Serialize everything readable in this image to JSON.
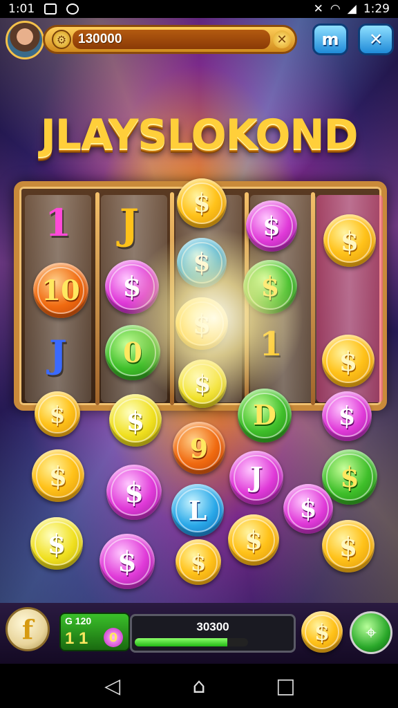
{
  "status_bar": {
    "time_left": "1:01",
    "time_right": "1:29"
  },
  "header": {
    "balance": "130000",
    "close_symbol": "✕",
    "menu_button_label": "m",
    "exit_button_label": "✕"
  },
  "game_title": "JLAYSLOKOND",
  "reel_symbols": [
    {
      "id": "r1-top",
      "label": "1",
      "style": "pink"
    },
    {
      "id": "r1-mid",
      "label": "10",
      "style": "orange"
    },
    {
      "id": "r1-bot",
      "label": "J",
      "style": "blue"
    },
    {
      "id": "r2-top",
      "label": "J",
      "style": "gold"
    },
    {
      "id": "r2-mid",
      "label": "$",
      "style": "pink"
    },
    {
      "id": "r2-bot",
      "label": "0",
      "style": "green"
    },
    {
      "id": "r3-top",
      "label": "$",
      "style": "gold"
    },
    {
      "id": "r3-mid",
      "label": "$",
      "style": "blue"
    },
    {
      "id": "r3-mid2",
      "label": "$",
      "style": "gold"
    },
    {
      "id": "r3-bot",
      "label": "$",
      "style": "yellow"
    },
    {
      "id": "r4-top",
      "label": "$",
      "style": "pink"
    },
    {
      "id": "r4-mid",
      "label": "$",
      "style": "green"
    },
    {
      "id": "r4-bot",
      "label": "1",
      "style": "gold"
    },
    {
      "id": "r5-top",
      "label": "$",
      "style": "gold"
    },
    {
      "id": "r5-bot",
      "label": "$",
      "style": "gold"
    }
  ],
  "coins_below": [
    {
      "label": "$",
      "style": "gold"
    },
    {
      "label": "$",
      "style": "yellow"
    },
    {
      "label": "D",
      "style": "green"
    },
    {
      "label": "$",
      "style": "pink"
    },
    {
      "label": "$",
      "style": "gold"
    },
    {
      "label": "$",
      "style": "pink"
    },
    {
      "label": "9",
      "style": "orange"
    },
    {
      "label": "J",
      "style": "pink"
    },
    {
      "label": "$",
      "style": "green"
    },
    {
      "label": "$",
      "style": "yellow"
    },
    {
      "label": "$",
      "style": "pink"
    },
    {
      "label": "L",
      "style": "blue"
    },
    {
      "label": "$",
      "style": "gold"
    },
    {
      "label": "$",
      "style": "pink"
    },
    {
      "label": "$",
      "style": "gold"
    },
    {
      "label": "$",
      "style": "gold"
    }
  ],
  "bottom_bar": {
    "left_coin_symbol": "f",
    "stat_top": "G 120",
    "stat_bottom": "1 1",
    "stat_chip": "0",
    "progress_label": "30300",
    "progress_fraction": 0.82,
    "right_coin_symbol": "$",
    "tag_symbol": "⌖"
  },
  "nav": {
    "back": "◁",
    "home": "⌂",
    "recents": "□"
  },
  "colors": {
    "gold": "#ffc21a",
    "frame": "#c98a3a",
    "progress_fill": "#22b814",
    "top_button": "#1f8ad8"
  }
}
